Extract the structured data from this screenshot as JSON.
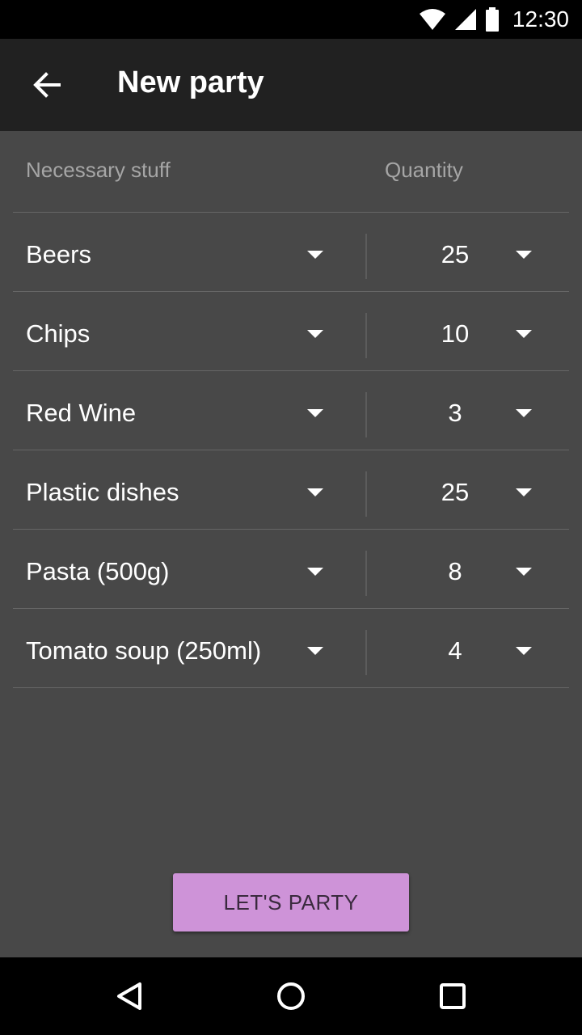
{
  "status_bar": {
    "time": "12:30",
    "icons": [
      "wifi-icon",
      "signal-icon",
      "battery-icon"
    ]
  },
  "app_bar": {
    "title": "New party",
    "back_icon": "arrow-back-icon"
  },
  "table": {
    "header_item": "Necessary stuff",
    "header_quantity": "Quantity",
    "rows": [
      {
        "item": "Beers",
        "quantity": "25"
      },
      {
        "item": "Chips",
        "quantity": "10"
      },
      {
        "item": "Red Wine",
        "quantity": "3"
      },
      {
        "item": "Plastic dishes",
        "quantity": "25"
      },
      {
        "item": "Pasta (500g)",
        "quantity": "8"
      },
      {
        "item": "Tomato soup (250ml)",
        "quantity": "4"
      }
    ]
  },
  "action_button": "LET'S PARTY",
  "nav_bar": {
    "icons": [
      "back-triangle-icon",
      "home-circle-icon",
      "recents-square-icon"
    ]
  },
  "colors": {
    "background": "#484848",
    "app_bar": "#212121",
    "accent": "#ce93d8"
  }
}
